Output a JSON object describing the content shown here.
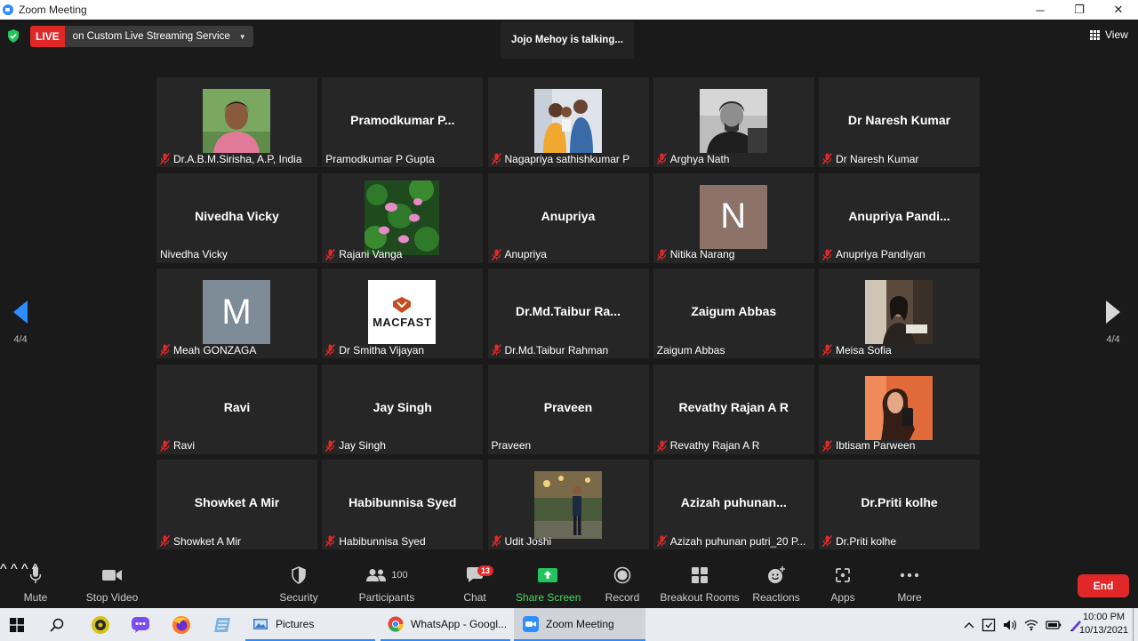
{
  "window": {
    "title": "Zoom Meeting",
    "controls": {
      "minimize": "─",
      "restore": "❐",
      "close": "✕"
    }
  },
  "header": {
    "live_label": "LIVE",
    "live_service": "on Custom Live Streaming Service",
    "talking": "Jojo Mehoy is talking...",
    "view_label": "View"
  },
  "pager": {
    "left": "4/4",
    "right": "4/4"
  },
  "participants": [
    {
      "label": "Dr.A.B.M.Sirisha, A.P, India",
      "bigname": "",
      "muted": true,
      "avatar": "photo-woman"
    },
    {
      "label": "Pramodkumar P Gupta",
      "bigname": "Pramodkumar  P...",
      "muted": false,
      "avatar": ""
    },
    {
      "label": "Nagapriya sathishkumar P",
      "bigname": "",
      "muted": true,
      "avatar": "photo-family"
    },
    {
      "label": "Arghya Nath",
      "bigname": "",
      "muted": true,
      "avatar": "photo-man-bw"
    },
    {
      "label": "Dr Naresh Kumar",
      "bigname": "Dr Naresh Kumar",
      "muted": true,
      "avatar": ""
    },
    {
      "label": "Nivedha Vicky",
      "bigname": "Nivedha Vicky",
      "muted": false,
      "avatar": ""
    },
    {
      "label": "Rajani Vanga",
      "bigname": "",
      "muted": true,
      "avatar": "photo-lotus"
    },
    {
      "label": "Anupriya",
      "bigname": "Anupriya",
      "muted": true,
      "avatar": ""
    },
    {
      "label": "Nitika Narang",
      "bigname": "",
      "muted": true,
      "avatar": "letter",
      "letter": "N",
      "color": "#8c7268"
    },
    {
      "label": "Anupriya Pandiyan",
      "bigname": "Anupriya  Pandi...",
      "muted": true,
      "avatar": ""
    },
    {
      "label": "Meah GONZAGA",
      "bigname": "",
      "muted": true,
      "avatar": "letter",
      "letter": "M",
      "color": "#7d8c96"
    },
    {
      "label": "Dr Smitha Vijayan",
      "bigname": "",
      "muted": true,
      "avatar": "logo-macfast",
      "logo_text": "MACFAST"
    },
    {
      "label": "Dr.Md.Taibur Rahman",
      "bigname": "Dr.Md.Taibur  Ra...",
      "muted": true,
      "avatar": ""
    },
    {
      "label": "Zaigum Abbas",
      "bigname": "Zaigum Abbas",
      "muted": false,
      "avatar": ""
    },
    {
      "label": "Meisa Sofia",
      "bigname": "",
      "muted": true,
      "avatar": "photo-woman-desk"
    },
    {
      "label": "Ravi",
      "bigname": "Ravi",
      "muted": true,
      "avatar": ""
    },
    {
      "label": "Jay Singh",
      "bigname": "Jay Singh",
      "muted": true,
      "avatar": ""
    },
    {
      "label": "Praveen",
      "bigname": "Praveen",
      "muted": false,
      "avatar": ""
    },
    {
      "label": "Revathy Rajan A R",
      "bigname": "Revathy Rajan A R",
      "muted": true,
      "avatar": ""
    },
    {
      "label": "Ibtisam Parween",
      "bigname": "",
      "muted": true,
      "avatar": "photo-woman-selfie"
    },
    {
      "label": "Showket A Mir",
      "bigname": "Showket A Mir",
      "muted": true,
      "avatar": ""
    },
    {
      "label": "Habibunnisa Syed",
      "bigname": "Habibunnisa Syed",
      "muted": true,
      "avatar": ""
    },
    {
      "label": "Udit Joshi",
      "bigname": "",
      "muted": true,
      "avatar": "photo-man-outdoor"
    },
    {
      "label": "Azizah puhunan putri_20 P...",
      "bigname": "Azizah  puhunan...",
      "muted": true,
      "avatar": ""
    },
    {
      "label": "Dr.Priti kolhe",
      "bigname": "Dr.Priti kolhe",
      "muted": true,
      "avatar": ""
    }
  ],
  "toolbar": {
    "mute": "Mute",
    "stop_video": "Stop Video",
    "security": "Security",
    "participants": "Participants",
    "participants_count": "100",
    "chat": "Chat",
    "chat_badge": "13",
    "share_screen": "Share Screen",
    "record": "Record",
    "breakout_rooms": "Breakout Rooms",
    "reactions": "Reactions",
    "apps": "Apps",
    "more": "More",
    "end": "End",
    "caret": "^"
  },
  "taskbar": {
    "pictures": "Pictures",
    "whatsapp": "WhatsApp - Googl...",
    "zoom": "Zoom Meeting",
    "time": "10:00 PM",
    "date": "10/13/2021"
  },
  "colors": {
    "accent": "#2d8cff",
    "live_red": "#e02828",
    "share_green": "#4fd363",
    "tile_bg": "#262626",
    "window_bg": "#1a1a1a"
  }
}
